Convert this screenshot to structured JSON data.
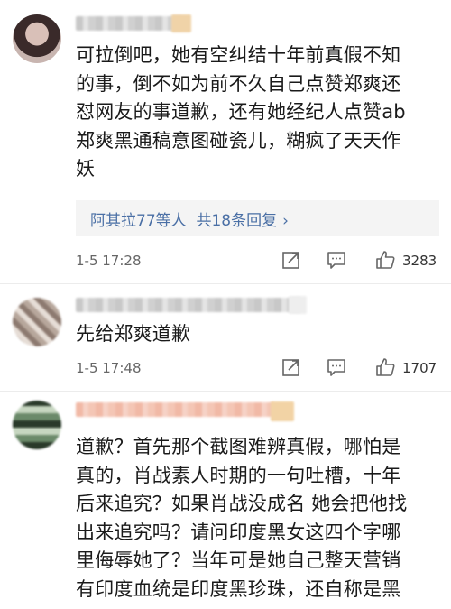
{
  "comments": [
    {
      "text_lines": [
        "可拉倒吧，她有空纠结十年前真假不知",
        "的事，倒不如为前不久自己点赞郑爽还",
        "怼网友的事道歉，还有她经纪人点赞ab",
        "郑爽黑通稿意图碰瓷儿，糊疯了天天作",
        "妖"
      ],
      "reply_summary": "阿其拉77等人  共18条回复",
      "reply_chevron": "›",
      "time": "1-5 17:28",
      "likes": "3283"
    },
    {
      "text_lines": [
        "先给郑爽道歉"
      ],
      "time": "1-5 17:48",
      "likes": "1707"
    },
    {
      "text_lines": [
        "道歉？首先那个截图难辨真假，哪怕是",
        "真的，肖战素人时期的一句吐槽，十年",
        "后来追究？如果肖战没成名 她会把他找",
        "出来追究吗？请问印度黑女这四个字哪",
        "里侮辱她了？当年可是她自己整天营销",
        "有印度血统是印度黑珍珠，还自称是黑"
      ]
    }
  ],
  "icons": {
    "share": "share-icon",
    "comment": "comment-icon",
    "like": "thumbs-up-icon"
  },
  "colors": {
    "reply_link": "#4a6fa5",
    "meta_text": "#666666",
    "reply_box_bg": "#f4f4f4"
  }
}
